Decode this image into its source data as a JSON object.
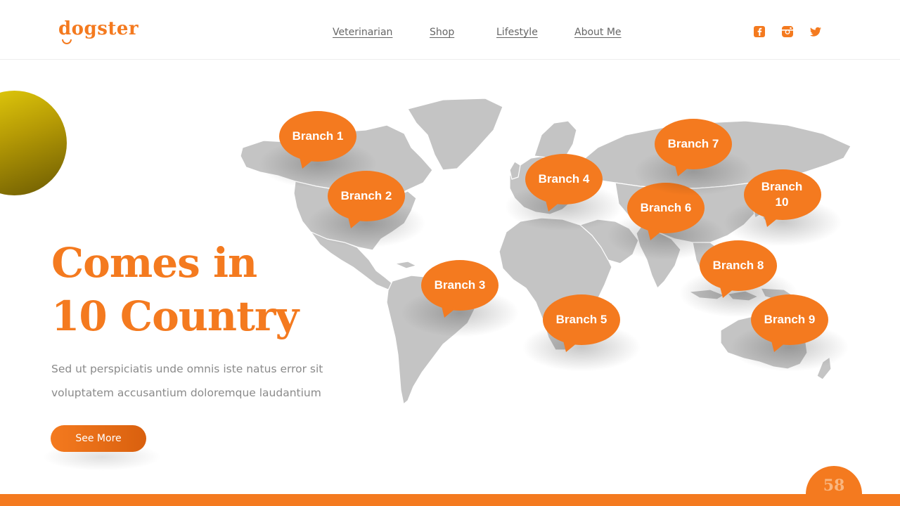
{
  "brand": {
    "logo_text": "dogster",
    "accent_color": "#f47a1f",
    "map_color": "#c4c4c4"
  },
  "nav": {
    "items": [
      {
        "label": "Veterinarian"
      },
      {
        "label": "Shop"
      },
      {
        "label": "Lifestyle"
      },
      {
        "label": "About Me"
      }
    ]
  },
  "social": {
    "icons": [
      "facebook-icon",
      "instagram-icon",
      "twitter-icon"
    ]
  },
  "main": {
    "headline_line1": "Comes in",
    "headline_line2": "10 Country",
    "description_line1": "Sed ut perspiciatis unde omnis iste natus error sit",
    "description_line2": "voluptatem accusantium doloremque laudantium",
    "cta_label": "See More"
  },
  "map": {
    "branches": [
      {
        "label": "Branch 1"
      },
      {
        "label": "Branch 2"
      },
      {
        "label": "Branch 3"
      },
      {
        "label": "Branch 4"
      },
      {
        "label": "Branch 5"
      },
      {
        "label": "Branch 6"
      },
      {
        "label": "Branch 7"
      },
      {
        "label": "Branch 8"
      },
      {
        "label": "Branch 9"
      },
      {
        "label": "Branch 10"
      }
    ]
  },
  "footer": {
    "page_number": "58"
  }
}
